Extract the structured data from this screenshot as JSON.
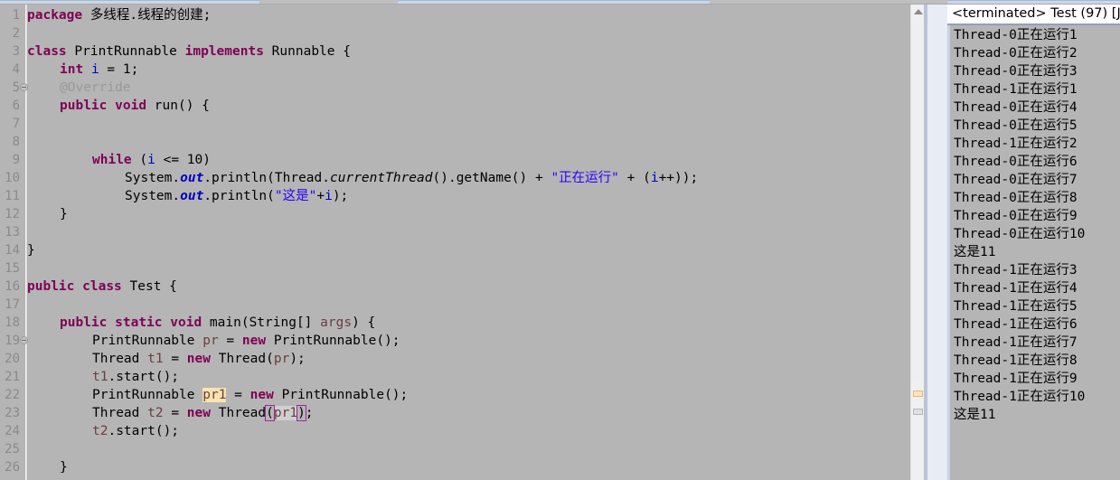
{
  "window": {
    "background_color": "#b5b5b5",
    "accent_color": "#c9d7ea"
  },
  "editor": {
    "name": "java-code-editor",
    "first_visible_line": 1,
    "last_visible_line": 26,
    "folding_lines": [
      5,
      18
    ],
    "occurrence_highlight_color": "#fae3b0",
    "selection_color": "#cfcfcf",
    "bracket_match_color": "#a5249b",
    "line_numbers": [
      "1",
      "2",
      "3",
      "4",
      "5",
      "6",
      "7",
      "8",
      "9",
      "10",
      "11",
      "12",
      "13",
      "14",
      "15",
      "16",
      "17",
      "18",
      "19",
      "20",
      "21",
      "22",
      "23",
      "24",
      "25",
      "26"
    ],
    "lines": [
      {
        "n": 1,
        "text": "package 多线程.线程的创建;"
      },
      {
        "n": 2,
        "text": ""
      },
      {
        "n": 3,
        "text": "class PrintRunnable implements Runnable {"
      },
      {
        "n": 4,
        "text": "    int i = 1;"
      },
      {
        "n": 5,
        "text": "    @Override"
      },
      {
        "n": 6,
        "text": "    public void run() {"
      },
      {
        "n": 7,
        "text": ""
      },
      {
        "n": 8,
        "text": ""
      },
      {
        "n": 9,
        "text": "        while (i <= 10)"
      },
      {
        "n": 10,
        "text": "            System.out.println(Thread.currentThread().getName() + \"正在运行\" + (i++));"
      },
      {
        "n": 11,
        "text": "            System.out.println(\"这是\"+i);"
      },
      {
        "n": 12,
        "text": "    }"
      },
      {
        "n": 13,
        "text": ""
      },
      {
        "n": 14,
        "text": "}"
      },
      {
        "n": 15,
        "text": ""
      },
      {
        "n": 16,
        "text": "public class Test {"
      },
      {
        "n": 17,
        "text": ""
      },
      {
        "n": 18,
        "text": "    public static void main(String[] args) {"
      },
      {
        "n": 19,
        "text": "        PrintRunnable pr = new PrintRunnable();"
      },
      {
        "n": 20,
        "text": "        Thread t1 = new Thread(pr);"
      },
      {
        "n": 21,
        "text": "        t1.start();"
      },
      {
        "n": 22,
        "text": "        PrintRunnable pr1 = new PrintRunnable();"
      },
      {
        "n": 23,
        "text": "        Thread t2 = new Thread(pr1);"
      },
      {
        "n": 24,
        "text": "        t2.start();"
      },
      {
        "n": 25,
        "text": ""
      },
      {
        "n": 26,
        "text": "    }"
      }
    ],
    "tokens": {
      "kw_package": "package",
      "kw_class": "class",
      "kw_implements": "implements",
      "kw_int": "int",
      "kw_public": "public",
      "kw_void": "void",
      "kw_while": "while",
      "kw_new": "new",
      "kw_static": "static",
      "annotation_override": "@Override",
      "package_name": "多线程.线程的创建;",
      "type_printrunnable": "PrintRunnable",
      "type_runnable": "Runnable",
      "type_thread": "Thread",
      "type_test": "Test",
      "type_string_array": "String[]",
      "string_running": "\"正在运行\"",
      "string_this_is": "\"这是\"",
      "var_i": "i",
      "var_pr": "pr",
      "var_pr1": "pr1",
      "var_t1": "t1",
      "var_t2": "t2",
      "var_args": "args"
    }
  },
  "scrollbar": {
    "name": "editor-vertical-scrollbar",
    "markers": [
      {
        "type": "occurrence",
        "color": "#fbe7bf"
      },
      {
        "type": "selection",
        "color": "#e0e0e0"
      }
    ]
  },
  "console": {
    "name": "console-view",
    "header": "<terminated> Test (97) [J",
    "lines": [
      "Thread-0正在运行1",
      "Thread-0正在运行2",
      "Thread-0正在运行3",
      "Thread-1正在运行1",
      "Thread-0正在运行4",
      "Thread-0正在运行5",
      "Thread-1正在运行2",
      "Thread-0正在运行6",
      "Thread-0正在运行7",
      "Thread-0正在运行8",
      "Thread-0正在运行9",
      "Thread-0正在运行10",
      "这是11",
      "Thread-1正在运行3",
      "Thread-1正在运行4",
      "Thread-1正在运行5",
      "Thread-1正在运行6",
      "Thread-1正在运行7",
      "Thread-1正在运行8",
      "Thread-1正在运行9",
      "Thread-1正在运行10",
      "这是11"
    ]
  }
}
